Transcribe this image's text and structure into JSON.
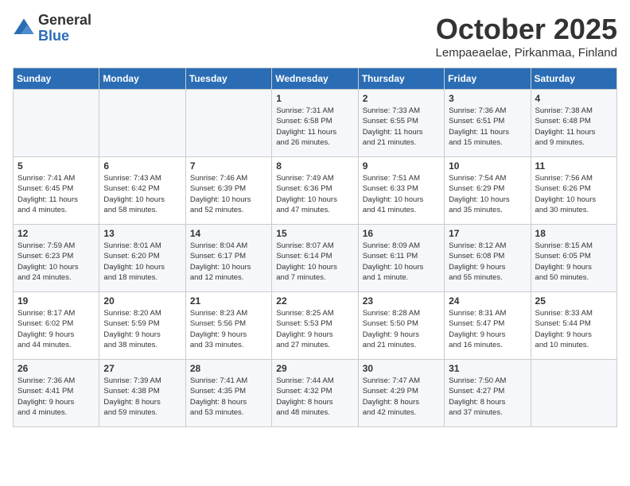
{
  "header": {
    "logo_general": "General",
    "logo_blue": "Blue",
    "month_title": "October 2025",
    "location": "Lempaeaelae, Pirkanmaa, Finland"
  },
  "days_of_week": [
    "Sunday",
    "Monday",
    "Tuesday",
    "Wednesday",
    "Thursday",
    "Friday",
    "Saturday"
  ],
  "weeks": [
    [
      {
        "day": "",
        "info": ""
      },
      {
        "day": "",
        "info": ""
      },
      {
        "day": "",
        "info": ""
      },
      {
        "day": "1",
        "info": "Sunrise: 7:31 AM\nSunset: 6:58 PM\nDaylight: 11 hours\nand 26 minutes."
      },
      {
        "day": "2",
        "info": "Sunrise: 7:33 AM\nSunset: 6:55 PM\nDaylight: 11 hours\nand 21 minutes."
      },
      {
        "day": "3",
        "info": "Sunrise: 7:36 AM\nSunset: 6:51 PM\nDaylight: 11 hours\nand 15 minutes."
      },
      {
        "day": "4",
        "info": "Sunrise: 7:38 AM\nSunset: 6:48 PM\nDaylight: 11 hours\nand 9 minutes."
      }
    ],
    [
      {
        "day": "5",
        "info": "Sunrise: 7:41 AM\nSunset: 6:45 PM\nDaylight: 11 hours\nand 4 minutes."
      },
      {
        "day": "6",
        "info": "Sunrise: 7:43 AM\nSunset: 6:42 PM\nDaylight: 10 hours\nand 58 minutes."
      },
      {
        "day": "7",
        "info": "Sunrise: 7:46 AM\nSunset: 6:39 PM\nDaylight: 10 hours\nand 52 minutes."
      },
      {
        "day": "8",
        "info": "Sunrise: 7:49 AM\nSunset: 6:36 PM\nDaylight: 10 hours\nand 47 minutes."
      },
      {
        "day": "9",
        "info": "Sunrise: 7:51 AM\nSunset: 6:33 PM\nDaylight: 10 hours\nand 41 minutes."
      },
      {
        "day": "10",
        "info": "Sunrise: 7:54 AM\nSunset: 6:29 PM\nDaylight: 10 hours\nand 35 minutes."
      },
      {
        "day": "11",
        "info": "Sunrise: 7:56 AM\nSunset: 6:26 PM\nDaylight: 10 hours\nand 30 minutes."
      }
    ],
    [
      {
        "day": "12",
        "info": "Sunrise: 7:59 AM\nSunset: 6:23 PM\nDaylight: 10 hours\nand 24 minutes."
      },
      {
        "day": "13",
        "info": "Sunrise: 8:01 AM\nSunset: 6:20 PM\nDaylight: 10 hours\nand 18 minutes."
      },
      {
        "day": "14",
        "info": "Sunrise: 8:04 AM\nSunset: 6:17 PM\nDaylight: 10 hours\nand 12 minutes."
      },
      {
        "day": "15",
        "info": "Sunrise: 8:07 AM\nSunset: 6:14 PM\nDaylight: 10 hours\nand 7 minutes."
      },
      {
        "day": "16",
        "info": "Sunrise: 8:09 AM\nSunset: 6:11 PM\nDaylight: 10 hours\nand 1 minute."
      },
      {
        "day": "17",
        "info": "Sunrise: 8:12 AM\nSunset: 6:08 PM\nDaylight: 9 hours\nand 55 minutes."
      },
      {
        "day": "18",
        "info": "Sunrise: 8:15 AM\nSunset: 6:05 PM\nDaylight: 9 hours\nand 50 minutes."
      }
    ],
    [
      {
        "day": "19",
        "info": "Sunrise: 8:17 AM\nSunset: 6:02 PM\nDaylight: 9 hours\nand 44 minutes."
      },
      {
        "day": "20",
        "info": "Sunrise: 8:20 AM\nSunset: 5:59 PM\nDaylight: 9 hours\nand 38 minutes."
      },
      {
        "day": "21",
        "info": "Sunrise: 8:23 AM\nSunset: 5:56 PM\nDaylight: 9 hours\nand 33 minutes."
      },
      {
        "day": "22",
        "info": "Sunrise: 8:25 AM\nSunset: 5:53 PM\nDaylight: 9 hours\nand 27 minutes."
      },
      {
        "day": "23",
        "info": "Sunrise: 8:28 AM\nSunset: 5:50 PM\nDaylight: 9 hours\nand 21 minutes."
      },
      {
        "day": "24",
        "info": "Sunrise: 8:31 AM\nSunset: 5:47 PM\nDaylight: 9 hours\nand 16 minutes."
      },
      {
        "day": "25",
        "info": "Sunrise: 8:33 AM\nSunset: 5:44 PM\nDaylight: 9 hours\nand 10 minutes."
      }
    ],
    [
      {
        "day": "26",
        "info": "Sunrise: 7:36 AM\nSunset: 4:41 PM\nDaylight: 9 hours\nand 4 minutes."
      },
      {
        "day": "27",
        "info": "Sunrise: 7:39 AM\nSunset: 4:38 PM\nDaylight: 8 hours\nand 59 minutes."
      },
      {
        "day": "28",
        "info": "Sunrise: 7:41 AM\nSunset: 4:35 PM\nDaylight: 8 hours\nand 53 minutes."
      },
      {
        "day": "29",
        "info": "Sunrise: 7:44 AM\nSunset: 4:32 PM\nDaylight: 8 hours\nand 48 minutes."
      },
      {
        "day": "30",
        "info": "Sunrise: 7:47 AM\nSunset: 4:29 PM\nDaylight: 8 hours\nand 42 minutes."
      },
      {
        "day": "31",
        "info": "Sunrise: 7:50 AM\nSunset: 4:27 PM\nDaylight: 8 hours\nand 37 minutes."
      },
      {
        "day": "",
        "info": ""
      }
    ]
  ]
}
